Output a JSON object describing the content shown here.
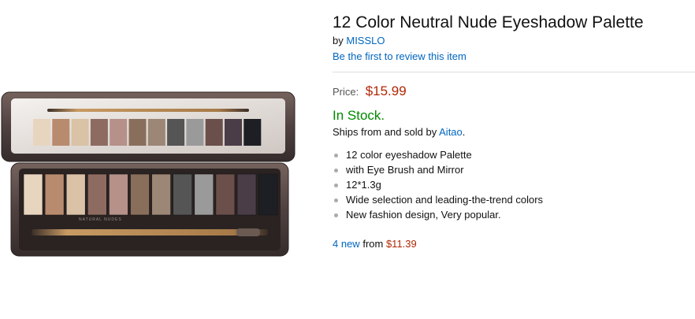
{
  "product": {
    "title": "12 Color Neutral Nude Eyeshadow Palette",
    "by_prefix": "by",
    "brand": "MISSLO",
    "review_link": "Be the first to review this item",
    "price_label": "Price:",
    "price": "$15.99",
    "stock": "In Stock.",
    "ships_prefix": "Ships from and sold by",
    "seller": "Aitao",
    "ships_suffix": ".",
    "features": [
      "12 color eyeshadow Palette",
      "with Eye Brush and Mirror",
      "12*1.3g",
      "Wide selection and leading-the-trend colors",
      "New fashion design, Very popular."
    ],
    "offers_link": "4 new",
    "offers_mid": "from",
    "offers_price": "$11.39"
  },
  "image": {
    "palette_text": "NATURAL NUDES",
    "shade_colors": [
      "#e8d5c0",
      "#b98b6e",
      "#d9c2a6",
      "#8e6b61",
      "#b59189",
      "#8a6e5c",
      "#9c8676",
      "#555555",
      "#9b9a9b",
      "#6a4f4b",
      "#4a3d47",
      "#1e1f24"
    ],
    "case_color": "#5b4b48",
    "brush_color": "#b88a55"
  },
  "colors": {
    "link": "#0066c0",
    "price": "#b12704",
    "stock": "#008a00"
  }
}
